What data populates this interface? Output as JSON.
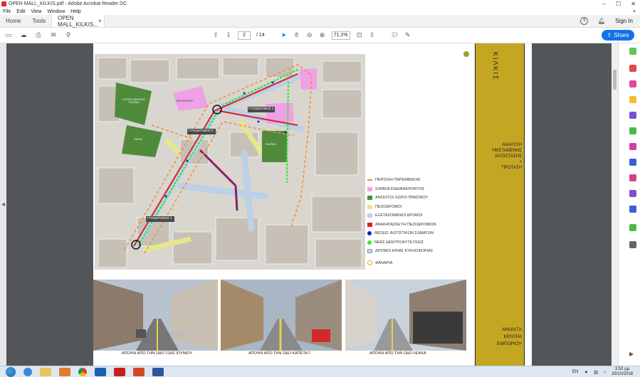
{
  "window": {
    "title": "OPEN MALL_KILKIS.pdf - Adobe Acrobat Reader DC",
    "controls": [
      "–",
      "☐",
      "✕"
    ]
  },
  "menu": [
    "File",
    "Edit",
    "View",
    "Window",
    "Help"
  ],
  "tabs": {
    "home": "Home",
    "tools": "Tools",
    "doc": "OPEN MALL_KILKIS...",
    "doc_close": "×",
    "sign_in": "Sign In"
  },
  "toolbar": {
    "page_current": "2",
    "page_total": "/ 14",
    "zoom": "71,1%",
    "share": "Share"
  },
  "document": {
    "legend": [
      {
        "label": "ΠΕΡΙΟΧΗ ΠΑΡΕΜΒΑΣΗΣ",
        "color": "#f0902b"
      },
      {
        "label": "ΣΗΜΕΙΑ ΕΝΔΙΑΦΕΡΟΝΤΟΣ",
        "color": "#f0a0e6"
      },
      {
        "label": "ΑΝΟΙΧΤΟΙ ΧΩΡΟΙ ΠΡΑΣΙΝΟΥ",
        "color": "#4f8b3b"
      },
      {
        "label": "ΠΕΖΟΔΡΟΜΟΙ",
        "color": "#e6e68c"
      },
      {
        "label": "ΕΞΕΤΑΖΟΜΕΝΟΙ ΔΡΟΜΟΙ",
        "color": "#bcd0e6"
      },
      {
        "label": "ΑΝΑΚΑΤΑΣΚΕΥΗ ΠΕΖΟΔΡΟΜΙΩΝ",
        "color": "#e01f1f"
      },
      {
        "label": "ΘΕΣΕΙΣ ΦΩΤΙΣΤΙΚΩΝ ΣΩΜΑΤΩΝ",
        "color": "#1a1adc"
      },
      {
        "label": "ΝΕΕΣ ΔΕΝΤΡΟΦΥΤΕΥΣΕΙΣ",
        "color": "#3ce63c"
      },
      {
        "label": "ΔΡΟΜΟΙ ΗΠΙΑΣ ΚΥΚΛΟΦΟΡΙΑΣ",
        "color": "#c8d4ee"
      },
      {
        "label": "ΦΑΝΑΡΙΑ",
        "color": "#e6a01f"
      }
    ],
    "map_labels": {
      "street_a": "ΓΥΠΟΔΡΟΜΟΣ 2",
      "street_b": "ΓΥΠΟΔΡΟΜΟΣ 3",
      "street_c": "ΓΥΠΟΔΡΟΜΟΣ 1",
      "green_1": "Ο ΑΓΙΟΣ ΝΙΚΟΛΑΟΣ ΠΛΑΤΕΙΑ",
      "green_2": "ΠΑΡΚΟ",
      "green_3": "ΠΛΑΤΕΙΑ",
      "poi": "ΜΗΤΡΟΠΟΛΗ"
    },
    "captions": [
      "ΑΠΟΨΗ ΑΠΟ ΤΗΝ ΟΔΟ 21ΗΣ ΙΟΥΝΙΟΥ",
      "ΑΠΟΨΗ ΑΠΟ ΤΗΝ ΟΔΟ ΚΑΠΕΤΑ Γ.",
      "ΑΠΟΨΗ ΑΠΟ ΤΗΝ ΟΔΟ ΛΕΚΚΑ"
    ],
    "panel_title": "ΚΙΛΚΙΣ",
    "panel_subtitle": [
      "ΑΝΑΛΥΣΗ",
      "ΥΦΙΣΤΑΜΕΝΗΣ",
      "ΚΑΤΑΣΤΑΣΗΣ",
      "+",
      "ΠΡΟΤΑΣΗ"
    ],
    "panel_footer": [
      "ΑΝΟΙΧΤΑ",
      "ΚΕΝΤΡΑ",
      "ΕΜΠΟΡΙΟΥ"
    ]
  },
  "taskbar": {
    "lang": "EN",
    "time": "3:52 μμ",
    "date": "25/10/2018"
  }
}
